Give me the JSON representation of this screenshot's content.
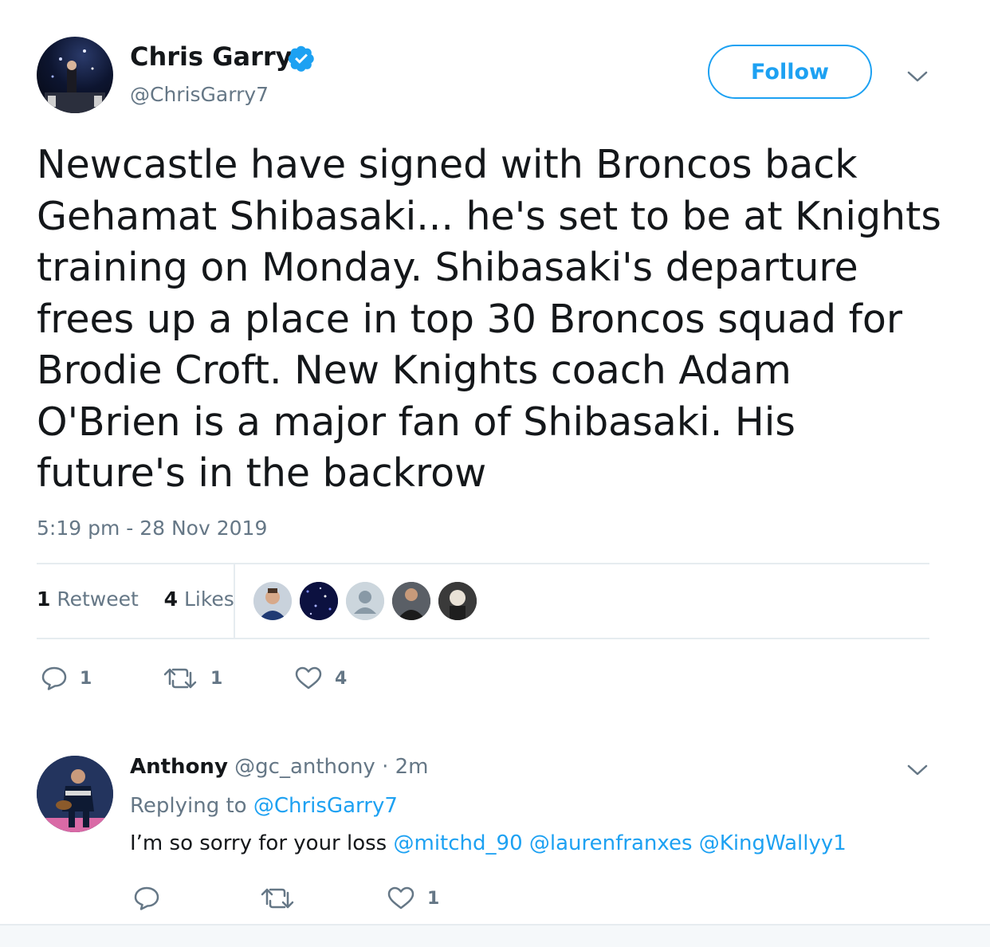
{
  "tweet": {
    "author_name": "Chris Garry",
    "author_handle": "@ChrisGarry7",
    "follow_label": "Follow",
    "text": "Newcastle have signed with Broncos back\nGehamat Shibasaki... he's set to be at Knights\ntraining on Monday. Shibasaki's departure\nfrees up a place in top 30 Broncos squad for\nBrodie Croft. New Knights coach Adam\nO'Brien is a major fan of Shibasaki. His\nfuture's in the backrow",
    "timestamp": "5:19 pm - 28 Nov 2019",
    "retweet_count": "1",
    "retweet_label": "Retweet",
    "like_count": "4",
    "like_label": "Likes",
    "actions": {
      "reply_count": "1",
      "retweet_count": "1",
      "like_count": "4"
    }
  },
  "reply": {
    "author_name": "Anthony",
    "author_handle": "@gc_anthony",
    "separator": "·",
    "time": "2m",
    "replying_prefix": "Replying to",
    "replying_to": "@ChrisGarry7",
    "text_prefix": "I’m so sorry for your loss",
    "mentions": [
      "@mitchd_90",
      "@laurenfranxes",
      "@KingWallyy1"
    ],
    "actions": {
      "like_count": "1"
    }
  },
  "colors": {
    "accent": "#1da1f2",
    "secondary_text": "#657786",
    "primary_text": "#14171a",
    "divider": "#e6ecf0"
  },
  "icons": [
    "verified-badge-icon",
    "chevron-down-icon",
    "reply-icon",
    "retweet-icon",
    "heart-icon",
    "default-avatar-icon"
  ]
}
